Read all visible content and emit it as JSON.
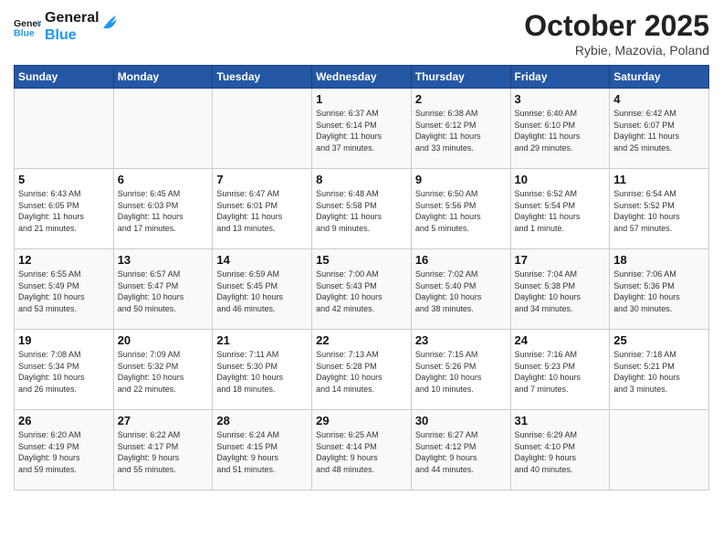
{
  "header": {
    "logo_line1": "General",
    "logo_line2": "Blue",
    "month": "October 2025",
    "location": "Rybie, Mazovia, Poland"
  },
  "weekdays": [
    "Sunday",
    "Monday",
    "Tuesday",
    "Wednesday",
    "Thursday",
    "Friday",
    "Saturday"
  ],
  "weeks": [
    [
      {
        "day": "",
        "info": ""
      },
      {
        "day": "",
        "info": ""
      },
      {
        "day": "",
        "info": ""
      },
      {
        "day": "1",
        "info": "Sunrise: 6:37 AM\nSunset: 6:14 PM\nDaylight: 11 hours\nand 37 minutes."
      },
      {
        "day": "2",
        "info": "Sunrise: 6:38 AM\nSunset: 6:12 PM\nDaylight: 11 hours\nand 33 minutes."
      },
      {
        "day": "3",
        "info": "Sunrise: 6:40 AM\nSunset: 6:10 PM\nDaylight: 11 hours\nand 29 minutes."
      },
      {
        "day": "4",
        "info": "Sunrise: 6:42 AM\nSunset: 6:07 PM\nDaylight: 11 hours\nand 25 minutes."
      }
    ],
    [
      {
        "day": "5",
        "info": "Sunrise: 6:43 AM\nSunset: 6:05 PM\nDaylight: 11 hours\nand 21 minutes."
      },
      {
        "day": "6",
        "info": "Sunrise: 6:45 AM\nSunset: 6:03 PM\nDaylight: 11 hours\nand 17 minutes."
      },
      {
        "day": "7",
        "info": "Sunrise: 6:47 AM\nSunset: 6:01 PM\nDaylight: 11 hours\nand 13 minutes."
      },
      {
        "day": "8",
        "info": "Sunrise: 6:48 AM\nSunset: 5:58 PM\nDaylight: 11 hours\nand 9 minutes."
      },
      {
        "day": "9",
        "info": "Sunrise: 6:50 AM\nSunset: 5:56 PM\nDaylight: 11 hours\nand 5 minutes."
      },
      {
        "day": "10",
        "info": "Sunrise: 6:52 AM\nSunset: 5:54 PM\nDaylight: 11 hours\nand 1 minute."
      },
      {
        "day": "11",
        "info": "Sunrise: 6:54 AM\nSunset: 5:52 PM\nDaylight: 10 hours\nand 57 minutes."
      }
    ],
    [
      {
        "day": "12",
        "info": "Sunrise: 6:55 AM\nSunset: 5:49 PM\nDaylight: 10 hours\nand 53 minutes."
      },
      {
        "day": "13",
        "info": "Sunrise: 6:57 AM\nSunset: 5:47 PM\nDaylight: 10 hours\nand 50 minutes."
      },
      {
        "day": "14",
        "info": "Sunrise: 6:59 AM\nSunset: 5:45 PM\nDaylight: 10 hours\nand 46 minutes."
      },
      {
        "day": "15",
        "info": "Sunrise: 7:00 AM\nSunset: 5:43 PM\nDaylight: 10 hours\nand 42 minutes."
      },
      {
        "day": "16",
        "info": "Sunrise: 7:02 AM\nSunset: 5:40 PM\nDaylight: 10 hours\nand 38 minutes."
      },
      {
        "day": "17",
        "info": "Sunrise: 7:04 AM\nSunset: 5:38 PM\nDaylight: 10 hours\nand 34 minutes."
      },
      {
        "day": "18",
        "info": "Sunrise: 7:06 AM\nSunset: 5:36 PM\nDaylight: 10 hours\nand 30 minutes."
      }
    ],
    [
      {
        "day": "19",
        "info": "Sunrise: 7:08 AM\nSunset: 5:34 PM\nDaylight: 10 hours\nand 26 minutes."
      },
      {
        "day": "20",
        "info": "Sunrise: 7:09 AM\nSunset: 5:32 PM\nDaylight: 10 hours\nand 22 minutes."
      },
      {
        "day": "21",
        "info": "Sunrise: 7:11 AM\nSunset: 5:30 PM\nDaylight: 10 hours\nand 18 minutes."
      },
      {
        "day": "22",
        "info": "Sunrise: 7:13 AM\nSunset: 5:28 PM\nDaylight: 10 hours\nand 14 minutes."
      },
      {
        "day": "23",
        "info": "Sunrise: 7:15 AM\nSunset: 5:26 PM\nDaylight: 10 hours\nand 10 minutes."
      },
      {
        "day": "24",
        "info": "Sunrise: 7:16 AM\nSunset: 5:23 PM\nDaylight: 10 hours\nand 7 minutes."
      },
      {
        "day": "25",
        "info": "Sunrise: 7:18 AM\nSunset: 5:21 PM\nDaylight: 10 hours\nand 3 minutes."
      }
    ],
    [
      {
        "day": "26",
        "info": "Sunrise: 6:20 AM\nSunset: 4:19 PM\nDaylight: 9 hours\nand 59 minutes."
      },
      {
        "day": "27",
        "info": "Sunrise: 6:22 AM\nSunset: 4:17 PM\nDaylight: 9 hours\nand 55 minutes."
      },
      {
        "day": "28",
        "info": "Sunrise: 6:24 AM\nSunset: 4:15 PM\nDaylight: 9 hours\nand 51 minutes."
      },
      {
        "day": "29",
        "info": "Sunrise: 6:25 AM\nSunset: 4:14 PM\nDaylight: 9 hours\nand 48 minutes."
      },
      {
        "day": "30",
        "info": "Sunrise: 6:27 AM\nSunset: 4:12 PM\nDaylight: 9 hours\nand 44 minutes."
      },
      {
        "day": "31",
        "info": "Sunrise: 6:29 AM\nSunset: 4:10 PM\nDaylight: 9 hours\nand 40 minutes."
      },
      {
        "day": "",
        "info": ""
      }
    ]
  ]
}
